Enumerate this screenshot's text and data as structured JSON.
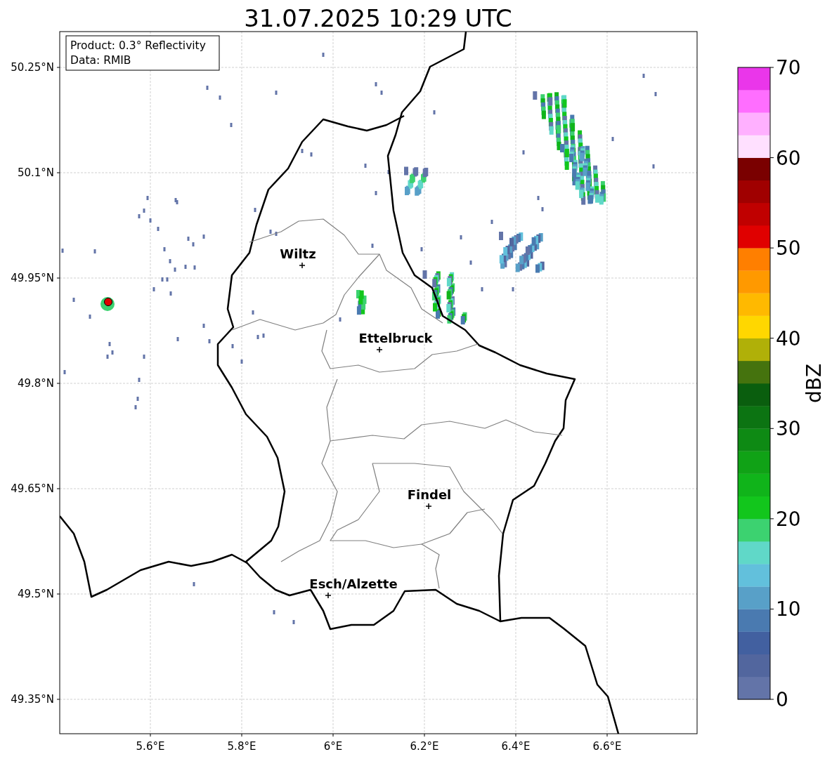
{
  "title": "31.07.2025 10:29 UTC",
  "info_box": {
    "lines": [
      "Product: 0.3° Reflectivity",
      "Data: RMIB"
    ]
  },
  "map": {
    "lat_ticks": [
      "50.25°N",
      "50.1°N",
      "49.95°N",
      "49.8°N",
      "49.65°N",
      "49.5°N",
      "49.35°N"
    ],
    "lon_ticks": [
      "5.6°E",
      "5.8°E",
      "6°E",
      "6.2°E",
      "6.4°E",
      "6.6°E"
    ],
    "places": [
      {
        "name": "Wiltz"
      },
      {
        "name": "Ettelbruck"
      },
      {
        "name": "Findel"
      },
      {
        "name": "Esch/Alzette"
      }
    ]
  },
  "colorbar": {
    "label": "dBZ",
    "ticks": [
      "70",
      "60",
      "50",
      "40",
      "30",
      "20",
      "10",
      "0"
    ],
    "levels": [
      {
        "color": "#6374a8"
      },
      {
        "color": "#52669e"
      },
      {
        "color": "#4260a0"
      },
      {
        "color": "#4a7ab0"
      },
      {
        "color": "#58a0c8"
      },
      {
        "color": "#62c0dc"
      },
      {
        "color": "#60d8c8"
      },
      {
        "color": "#3cd270"
      },
      {
        "color": "#12c61c"
      },
      {
        "color": "#10b41a"
      },
      {
        "color": "#10a216"
      },
      {
        "color": "#0e8a14"
      },
      {
        "color": "#0c7412"
      },
      {
        "color": "#0a5e0e"
      },
      {
        "color": "#45730e"
      },
      {
        "color": "#b0b008"
      },
      {
        "color": "#ffd700"
      },
      {
        "color": "#ffb900"
      },
      {
        "color": "#ff9900"
      },
      {
        "color": "#ff7f00"
      },
      {
        "color": "#e00000"
      },
      {
        "color": "#c00000"
      },
      {
        "color": "#a00000"
      },
      {
        "color": "#7a0000"
      },
      {
        "color": "#ffe0ff"
      },
      {
        "color": "#ffb0ff"
      },
      {
        "color": "#ff6eff"
      },
      {
        "color": "#ea36ea"
      }
    ]
  }
}
